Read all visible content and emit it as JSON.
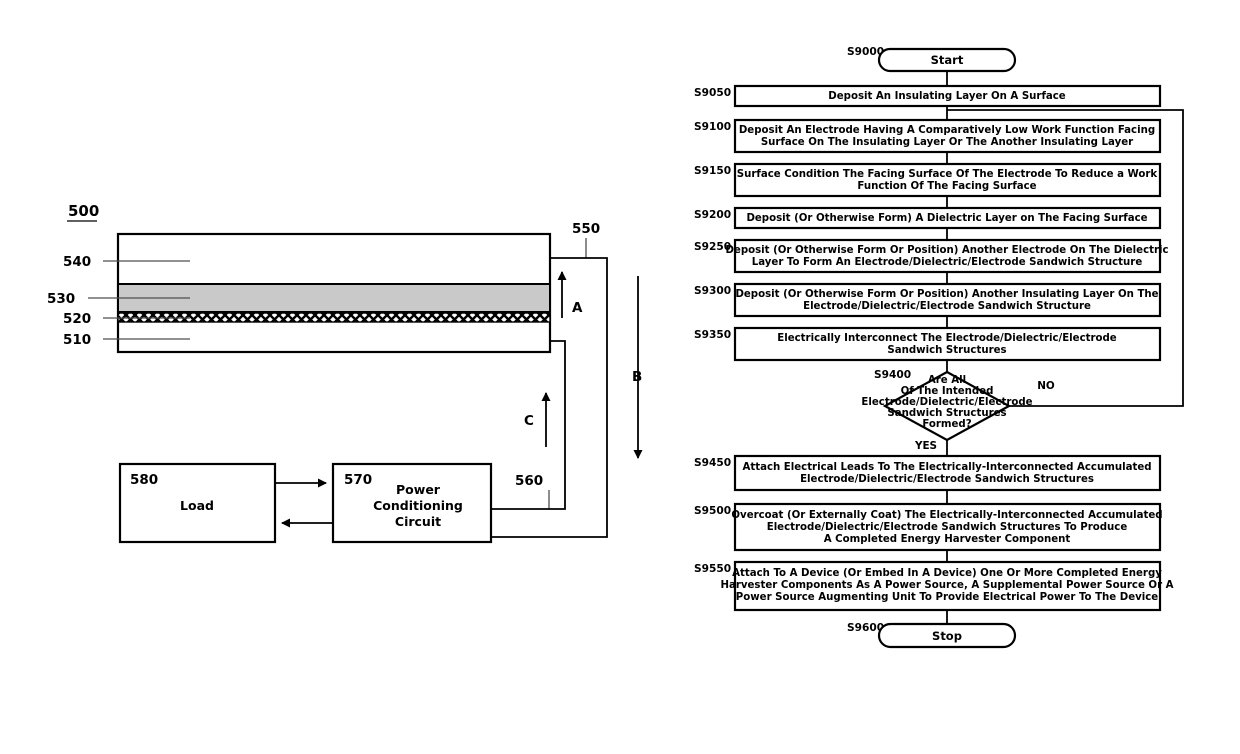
{
  "figure": {
    "left_diagram": {
      "id_label": "500",
      "reference_numbers": {
        "substrate": "510",
        "electrode_interface": "520",
        "dielectric": "530",
        "top_layer": "540",
        "lead_right": "550",
        "lead_lower": "560"
      },
      "flow_arrows": [
        {
          "name": "A",
          "label": "A",
          "direction": "up"
        },
        {
          "name": "B",
          "label": "B",
          "direction": "down"
        },
        {
          "name": "C",
          "label": "C",
          "direction": "up"
        }
      ],
      "blocks": [
        {
          "ref": "580",
          "label": "Load",
          "lines": [
            "Load"
          ]
        },
        {
          "ref": "570",
          "label": "Power Conditioning Circuit",
          "lines": [
            "Power",
            "Conditioning",
            "Circuit"
          ]
        }
      ]
    },
    "flowchart": {
      "start": {
        "step": "S9000",
        "label": "Start"
      },
      "stop": {
        "step": "S9600",
        "label": "Stop"
      },
      "decision": {
        "step": "S9400",
        "lines": [
          "Are All",
          "Of The Intended",
          "Electrode/Dielectric/Electrode",
          "Sandwich Structures",
          "Formed?"
        ],
        "yes_label": "YES",
        "no_label": "NO"
      },
      "steps": [
        {
          "step": "S9050",
          "lines": [
            "Deposit An Insulating Layer On A Surface"
          ]
        },
        {
          "step": "S9100",
          "lines": [
            "Deposit An Electrode Having A Comparatively Low Work Function Facing",
            "Surface On The Insulating Layer Or The Another Insulating Layer"
          ]
        },
        {
          "step": "S9150",
          "lines": [
            "Surface Condition The Facing Surface Of The Electrode To Reduce a Work",
            "Function Of The Facing Surface"
          ]
        },
        {
          "step": "S9200",
          "lines": [
            "Deposit (Or Otherwise Form) A Dielectric Layer on The Facing Surface"
          ]
        },
        {
          "step": "S9250",
          "lines": [
            "Deposit (Or Otherwise Form Or Position) Another Electrode On The Dielectric",
            "Layer To Form An Electrode/Dielectric/Electrode Sandwich Structure"
          ]
        },
        {
          "step": "S9300",
          "lines": [
            "Deposit (Or Otherwise Form Or Position) Another Insulating Layer On The",
            "Electrode/Dielectric/Electrode Sandwich Structure"
          ]
        },
        {
          "step": "S9350",
          "lines": [
            "Electrically Interconnect The Electrode/Dielectric/Electrode",
            "Sandwich Structures"
          ]
        },
        {
          "step": "S9450",
          "lines": [
            "Attach Electrical Leads To The Electrically-Interconnected Accumulated",
            "Electrode/Dielectric/Electrode Sandwich Structures"
          ]
        },
        {
          "step": "S9500",
          "lines": [
            "Overcoat (Or Externally Coat) The Electrically-Interconnected Accumulated",
            "Electrode/Dielectric/Electrode Sandwich Structures To Produce",
            "A Completed Energy Harvester Component"
          ]
        },
        {
          "step": "S9550",
          "lines": [
            "Attach To A Device (Or Embed In A Device) One Or More Completed Energy",
            "Harvester Components As A Power Source, A Supplemental Power Source Or A",
            "Power Source Augmenting Unit To Provide Electrical Power To The Device"
          ]
        }
      ]
    }
  },
  "colors": {
    "line": "#000000",
    "lead": "#4d4d4d",
    "dielectric_fill": "#c9c9c9",
    "background": "#ffffff"
  }
}
